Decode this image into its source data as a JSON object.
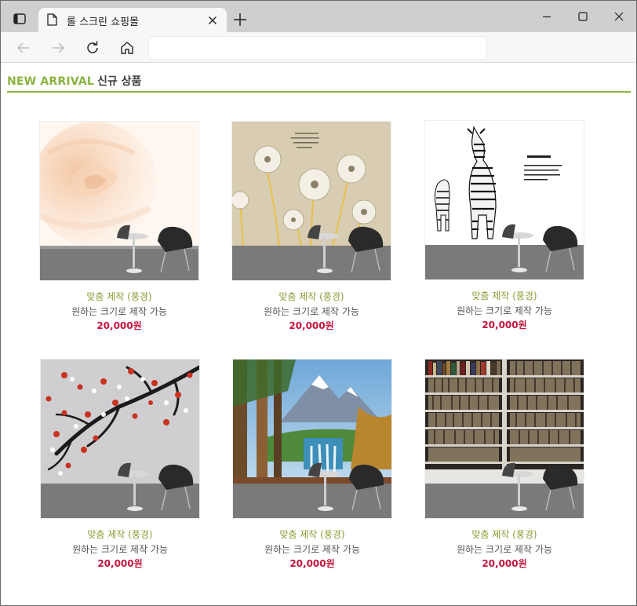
{
  "browser": {
    "tab_title": "롤 스크린 쇼핑몰",
    "address_value": "",
    "icons": {
      "tab_actions": "tab-actions-icon",
      "favicon": "page-icon",
      "close": "close-icon",
      "new_tab": "plus-icon",
      "minimize": "minimize-icon",
      "maximize": "maximize-icon",
      "window_close": "close-icon",
      "back": "back-arrow-icon",
      "forward": "forward-arrow-icon",
      "refresh": "refresh-icon",
      "home": "home-icon"
    }
  },
  "section": {
    "title_en": "NEW ARRIVAL",
    "title_ko": "신규 상품"
  },
  "colors": {
    "accent": "#8db545",
    "product_title": "#8b9c33",
    "price": "#c4143c"
  },
  "products": [
    {
      "title": "맞춤 제작 (풍경)",
      "desc": "원하는 크기로 제작 가능",
      "price": "20,000원",
      "image": "rose wallpaper with chairs"
    },
    {
      "title": "맞춤 제작 (풍경)",
      "desc": "원하는 크기로 제작 가능",
      "price": "20,000원",
      "image": "dandelion wallpaper with chairs"
    },
    {
      "title": "맞춤 제작 (풍경)",
      "desc": "원하는 크기로 제작 가능",
      "price": "20,000원",
      "image": "zebra wallpaper with chairs"
    },
    {
      "title": "맞춤 제작 (풍경)",
      "desc": "원하는 크기로 제작 가능",
      "price": "20,000원",
      "image": "cherry blossom wallpaper with chairs"
    },
    {
      "title": "맞춤 제작 (풍경)",
      "desc": "원하는 크기로 제작 가능",
      "price": "20,000원",
      "image": "mountain waterfall wallpaper with chairs"
    },
    {
      "title": "맞춤 제작 (풍경)",
      "desc": "원하는 크기로 제작 가능",
      "price": "20,000원",
      "image": "bookshelf wallpaper with chairs"
    }
  ]
}
